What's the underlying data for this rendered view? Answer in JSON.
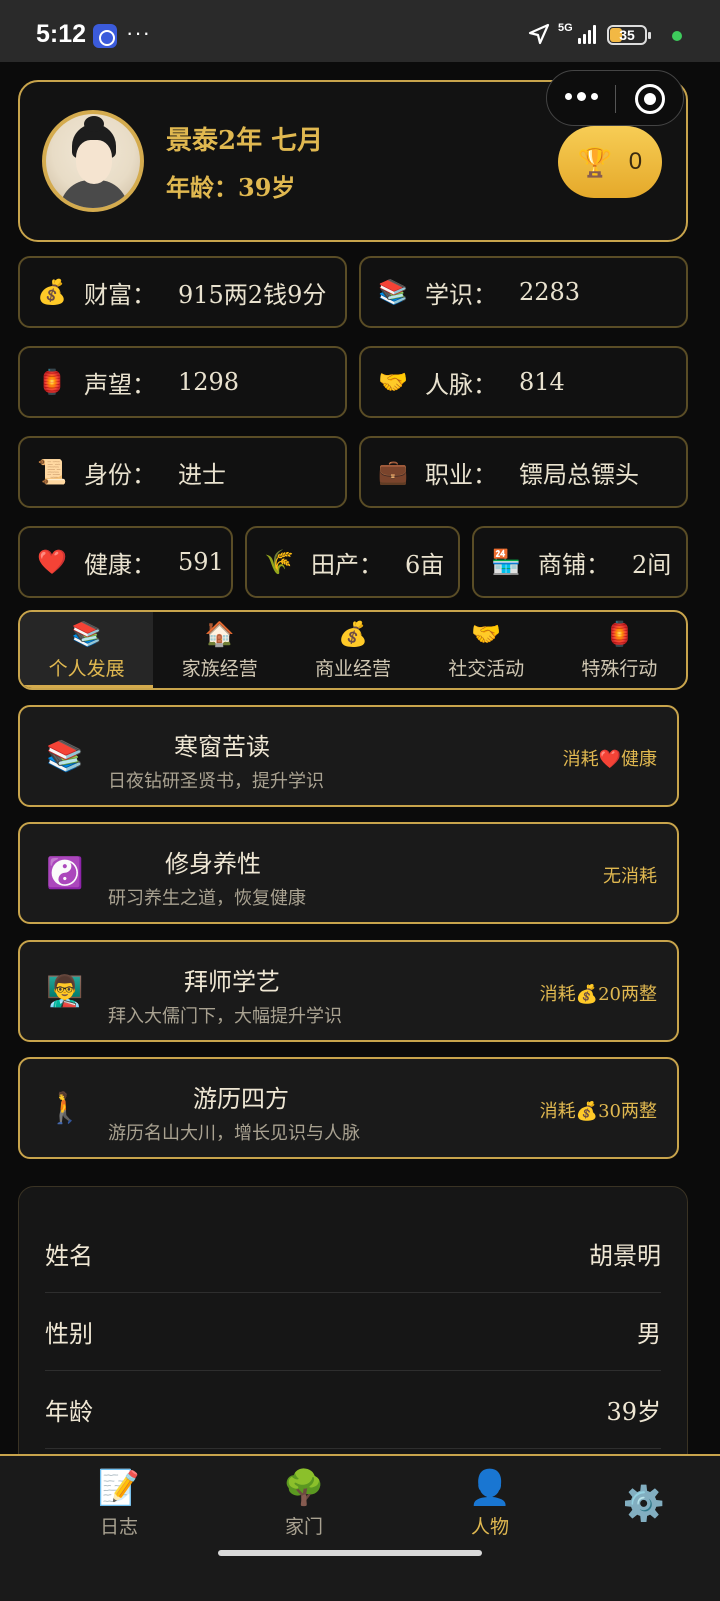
{
  "status_bar": {
    "time": "5:12",
    "network": "5G",
    "battery": "35"
  },
  "header": {
    "era": "景泰2年 七月",
    "age_label": "年龄：",
    "age_value": "39岁",
    "trophy_count": "0"
  },
  "stats": [
    {
      "icon": "💰",
      "label": "财富：",
      "value": "915两2钱9分"
    },
    {
      "icon": "📚",
      "label": "学识：",
      "value": "2283"
    },
    {
      "icon": "🏮",
      "label": "声望：",
      "value": "1298"
    },
    {
      "icon": "🤝",
      "label": "人脉：",
      "value": "814"
    },
    {
      "icon": "📜",
      "label": "身份：",
      "value": "进士"
    },
    {
      "icon": "💼",
      "label": "职业：",
      "value": "镖局总镖头"
    },
    {
      "icon": "❤️",
      "label": "健康：",
      "value": "591"
    },
    {
      "icon": "🌾",
      "label": "田产：",
      "value": "6亩"
    },
    {
      "icon": "🏪",
      "label": "商铺：",
      "value": "2间"
    }
  ],
  "tabs": [
    {
      "icon": "📚",
      "label": "个人发展"
    },
    {
      "icon": "🏠",
      "label": "家族经营"
    },
    {
      "icon": "💰",
      "label": "商业经营"
    },
    {
      "icon": "🤝",
      "label": "社交活动"
    },
    {
      "icon": "🏮",
      "label": "特殊行动"
    }
  ],
  "actions": [
    {
      "icon": "📚",
      "title": "寒窗苦读",
      "desc": "日夜钻研圣贤书，提升学识",
      "cost": "消耗❤️健康"
    },
    {
      "icon": "☯️",
      "title": "修身养性",
      "desc": "研习养生之道，恢复健康",
      "cost": "无消耗"
    },
    {
      "icon": "👨‍🏫",
      "title": "拜师学艺",
      "desc": "拜入大儒门下，大幅提升学识",
      "cost": "消耗💰20两整"
    },
    {
      "icon": "🚶",
      "title": "游历四方",
      "desc": "游历名山大川，增长见识与人脉",
      "cost": "消耗💰30两整"
    }
  ],
  "info": [
    {
      "key": "姓名",
      "value": "胡景明"
    },
    {
      "key": "性别",
      "value": "男"
    },
    {
      "key": "年龄",
      "value": "39岁"
    }
  ],
  "bottom_nav": [
    {
      "icon": "📝",
      "label": "日志"
    },
    {
      "icon": "🌳",
      "label": "家门"
    },
    {
      "icon": "👤",
      "label": "人物"
    },
    {
      "icon": "⚙️",
      "label": ""
    }
  ],
  "colors": {
    "gold": "#e0b850",
    "border_gold": "#c8a44c",
    "background": "#0b0b0b"
  }
}
